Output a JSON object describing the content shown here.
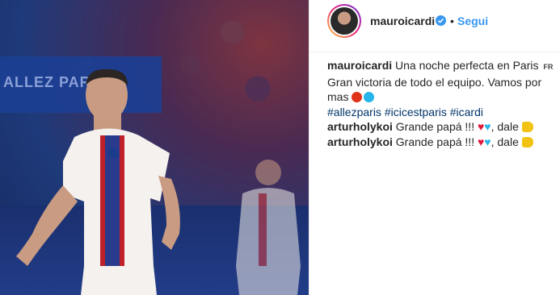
{
  "post": {
    "username": "mauroicardi",
    "separator": "•",
    "follow_label": "Segui",
    "caption_line1": "Una noche perfecta en Paris",
    "caption_flag": "FR",
    "caption_line2": "Gran victoria de todo el equipo. Vamos por mas",
    "hashtags": [
      "#allezparis",
      "#icicestparis",
      "#icardi"
    ]
  },
  "photo": {
    "banner_text": "ALLEZ PARIS"
  },
  "comments": [
    {
      "user": "arturholykoi",
      "text": "Grande papá !!!",
      "suffix": ", dale"
    },
    {
      "user": "arturholykoi",
      "text": "Grande papá !!!",
      "suffix": ", dale"
    }
  ],
  "icons": [
    "verified-badge-icon",
    "red-circle-emoji",
    "blue-circle-emoji",
    "red-heart-emoji",
    "blue-heart-emoji",
    "flexed-biceps-emoji"
  ],
  "colors": {
    "follow": "#3897f0",
    "hashtag": "#003569",
    "text": "#262626"
  }
}
